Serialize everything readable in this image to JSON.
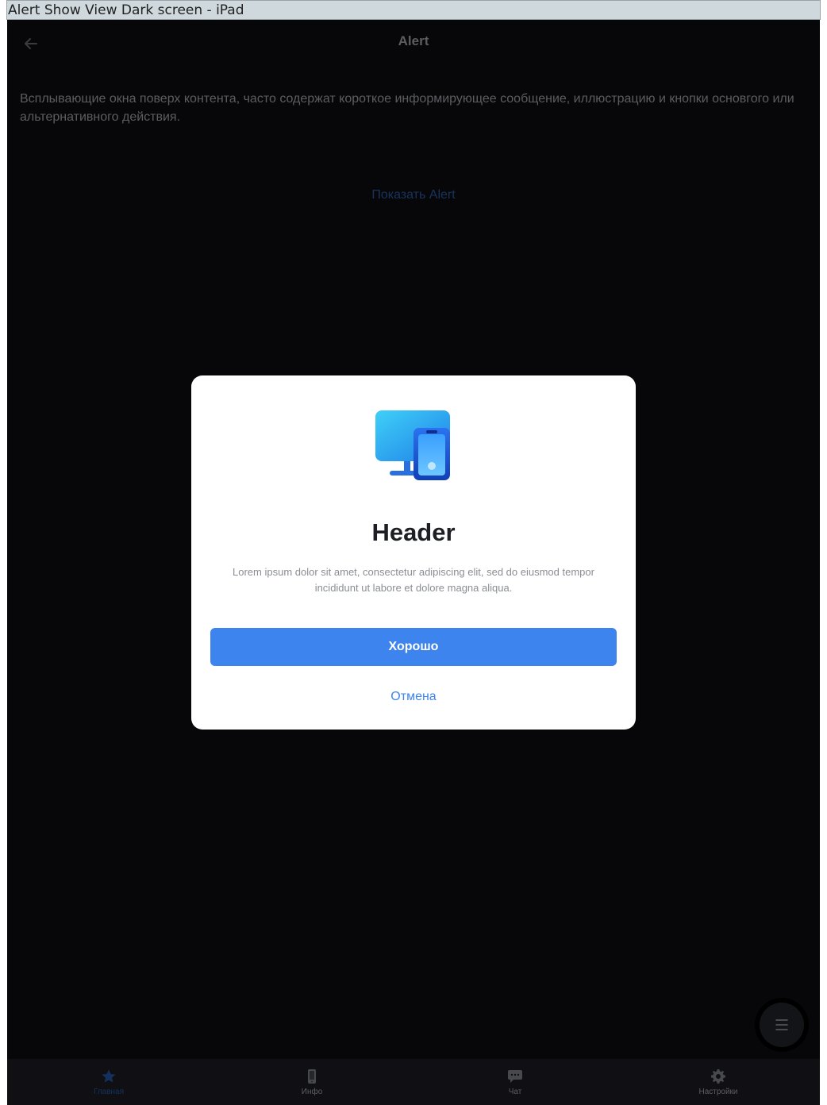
{
  "frame": {
    "title": "Alert Show View Dark screen - iPad"
  },
  "nav": {
    "title": "Alert",
    "back_icon": "arrow-left-icon"
  },
  "main": {
    "description": "Всплывающие окна поверх контента, часто содержат короткое информирующее сообщение, иллюстрацию и кнопки основгого или альтернативного действия.",
    "show_alert_label": "Показать Alert"
  },
  "dialog": {
    "icon": "devices-icon",
    "title": "Header",
    "body": "Lorem ipsum dolor sit amet, consectetur adipiscing elit, sed do eiusmod tempor incididunt ut labore et dolore magna aliqua.",
    "ok_label": "Хорошо",
    "cancel_label": "Отмена"
  },
  "fab": {
    "icon": "menu-icon"
  },
  "tabbar": {
    "items": [
      {
        "label": "Главная",
        "icon": "star-icon",
        "active": true
      },
      {
        "label": "Инфо",
        "icon": "phone-icon",
        "active": false
      },
      {
        "label": "Чат",
        "icon": "chat-icon",
        "active": false
      },
      {
        "label": "Настройки",
        "icon": "gear-icon",
        "active": false
      }
    ]
  },
  "colors": {
    "background": "#0b0b0f",
    "accent": "#3d84ee",
    "tab_active": "#1f4c8f",
    "muted_text": "#8d8f95"
  }
}
